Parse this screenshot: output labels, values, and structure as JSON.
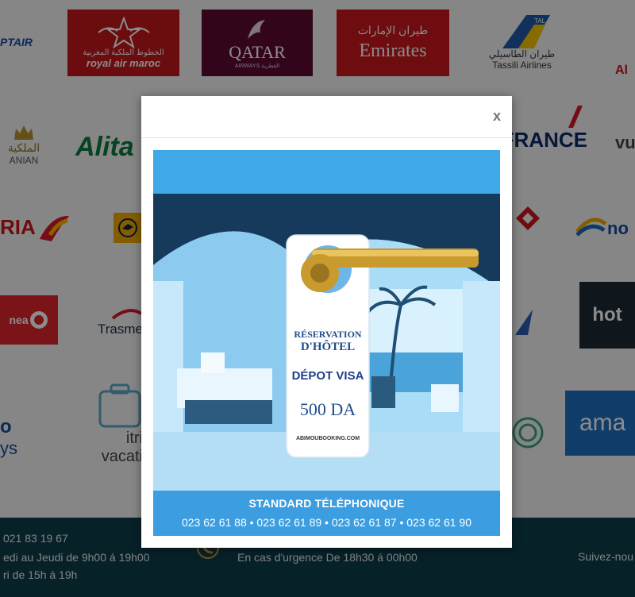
{
  "logos": {
    "row1": {
      "egyptair": "PTAIR",
      "royal_air_maroc": "royal air maroc",
      "royal_air_maroc_ar": "الخطوط الملكية المغربية",
      "qatar": "QATAR",
      "qatar_sub": "AIRWAYS القطرية",
      "emirates": "Emirates",
      "emirates_ar": "طيران الإمارات",
      "tassili": "Tassili Airlines",
      "tassili_ar": "طيران الطاسيلي",
      "tassili_tail": "TAL",
      "far_right": "Al"
    },
    "row2": {
      "royal_jordanian": "ANIAN",
      "royal_jordanian_ar": "الملكية",
      "alitalia": "Alita",
      "airfrance": "AIRFRANCE",
      "vueling": "vu"
    },
    "row3": {
      "iberia": "RIA",
      "nouvelair": "no"
    },
    "row4": {
      "corsair": "nea",
      "trasmed": "Trasme",
      "hotels": "hot"
    },
    "row5": {
      "lowcost": "o",
      "lowcost_sub": "ys",
      "itri_title": "itri",
      "itri_sub": "vacati",
      "amadeus": "ama"
    }
  },
  "footer": {
    "phone": "021 83 19 67",
    "hours1": "edi au Jeudi de 9h00 á 19h00",
    "hours2": "ri de 15h á 19h",
    "urgence": "En cas d'urgence De 18h30 á 00h00",
    "follow": "Suivez-nou"
  },
  "modal": {
    "close_label": "x",
    "promo": {
      "hanger_line1": "RÉSERVATION",
      "hanger_line2": "D'HÔTEL",
      "hanger_visa": "DÉPOT VISA",
      "hanger_price": "500 DA",
      "hanger_brand": "ABIMOUBOOKING.COM",
      "standard_label": "STANDARD TÉLÉPHONIQUE",
      "phones": "023 62 61 88 • 023 62 61 89 • 023 62 61 87 • 023 62 61 90"
    }
  },
  "colors": {
    "footer_bg": "#0d3d4b",
    "promo_blue": "#3fa9e8",
    "hanger_text": "#1f4f8c"
  }
}
